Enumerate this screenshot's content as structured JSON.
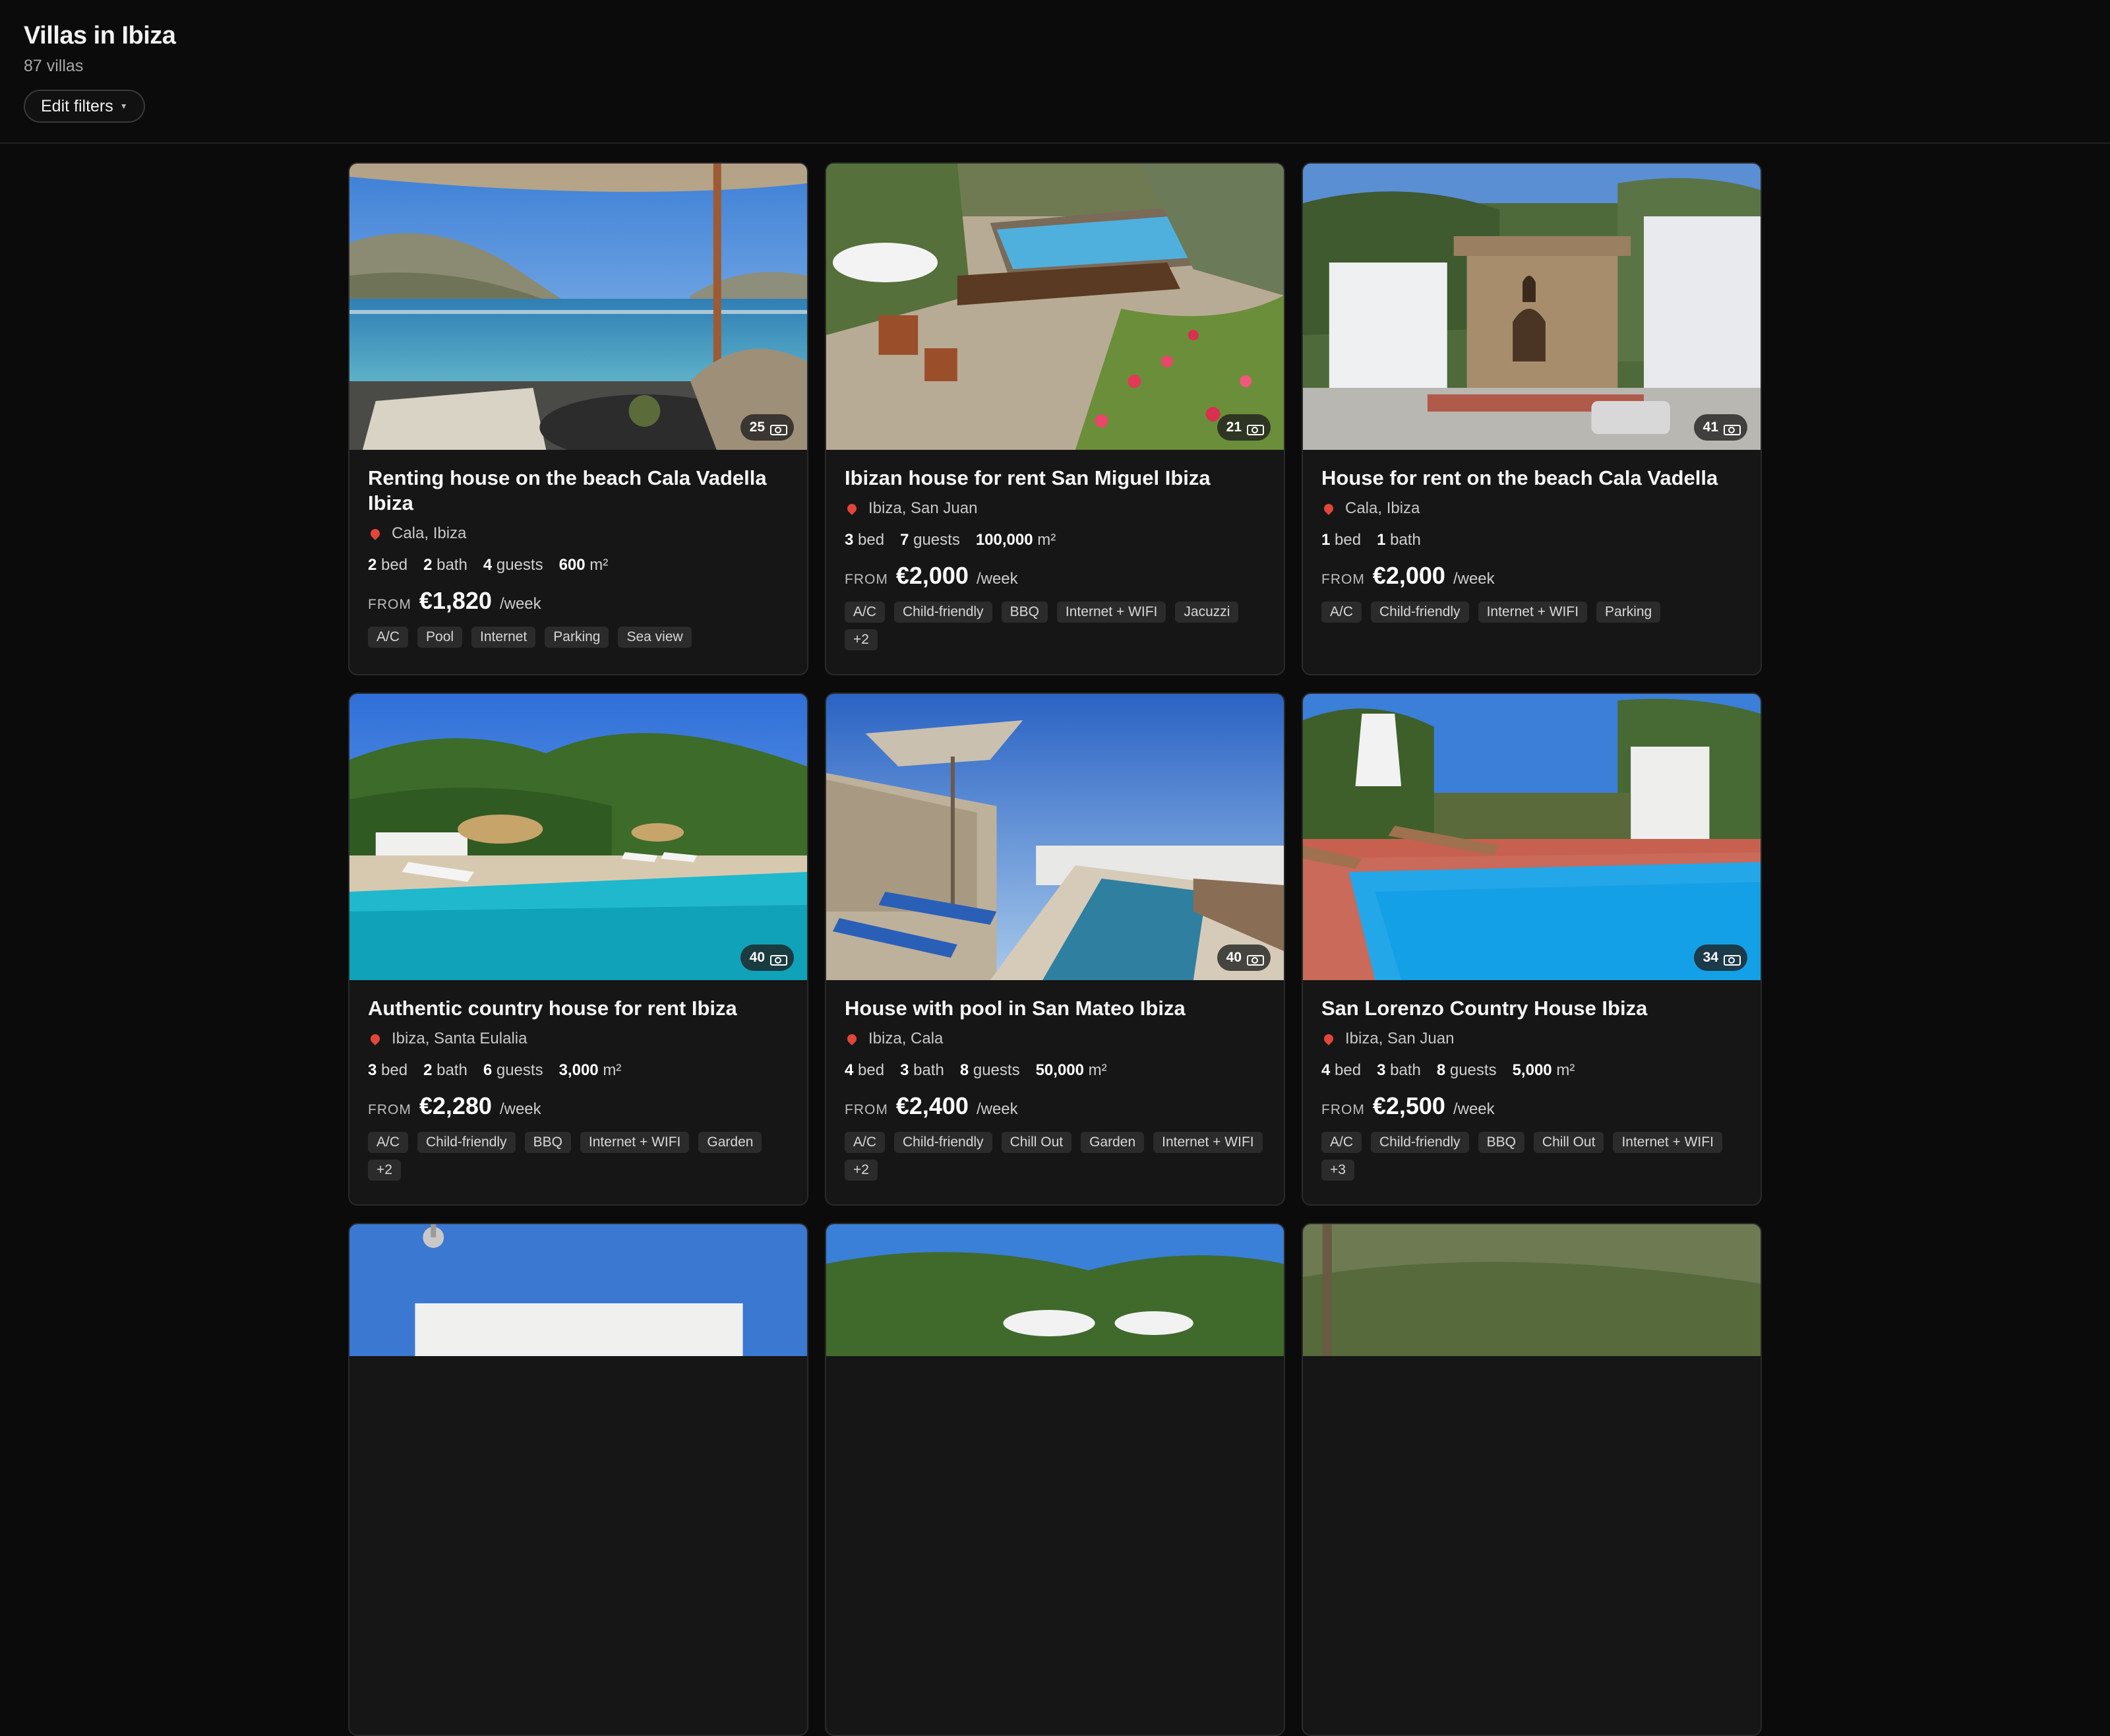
{
  "page": {
    "title": "Villas in Ibiza",
    "count": "87 villas",
    "filters_label": "Edit filters"
  },
  "listings": [
    {
      "title": "Renting house on the beach Cala Vadella Ibiza",
      "location": "Cala, Ibiza",
      "photos": "25",
      "stats": [
        {
          "value": "2",
          "unit": "bed"
        },
        {
          "value": "2",
          "unit": "bath"
        },
        {
          "value": "4",
          "unit": "guests"
        },
        {
          "value": "600",
          "unit": "m²"
        }
      ],
      "from": "FROM",
      "price": "€1,820",
      "per": "/week",
      "tags": [
        "A/C",
        "Pool",
        "Internet",
        "Parking",
        "Sea view"
      ]
    },
    {
      "title": "Ibizan house for rent San Miguel Ibiza",
      "location": "Ibiza, San Juan",
      "photos": "21",
      "stats": [
        {
          "value": "3",
          "unit": "bed"
        },
        {
          "value": "7",
          "unit": "guests"
        },
        {
          "value": "100,000",
          "unit": "m²"
        }
      ],
      "from": "FROM",
      "price": "€2,000",
      "per": "/week",
      "tags": [
        "A/C",
        "Child-friendly",
        "BBQ",
        "Internet + WIFI",
        "Jacuzzi",
        "+2"
      ]
    },
    {
      "title": "House for rent on the beach Cala Vadella",
      "location": "Cala, Ibiza",
      "photos": "41",
      "stats": [
        {
          "value": "1",
          "unit": "bed"
        },
        {
          "value": "1",
          "unit": "bath"
        }
      ],
      "from": "FROM",
      "price": "€2,000",
      "per": "/week",
      "tags": [
        "A/C",
        "Child-friendly",
        "Internet + WIFI",
        "Parking"
      ]
    },
    {
      "title": "Authentic country house for rent Ibiza",
      "location": "Ibiza, Santa Eulalia",
      "photos": "40",
      "stats": [
        {
          "value": "3",
          "unit": "bed"
        },
        {
          "value": "2",
          "unit": "bath"
        },
        {
          "value": "6",
          "unit": "guests"
        },
        {
          "value": "3,000",
          "unit": "m²"
        }
      ],
      "from": "FROM",
      "price": "€2,280",
      "per": "/week",
      "tags": [
        "A/C",
        "Child-friendly",
        "BBQ",
        "Internet + WIFI",
        "Garden",
        "+2"
      ]
    },
    {
      "title": "House with pool in San Mateo Ibiza",
      "location": "Ibiza, Cala",
      "photos": "40",
      "stats": [
        {
          "value": "4",
          "unit": "bed"
        },
        {
          "value": "3",
          "unit": "bath"
        },
        {
          "value": "8",
          "unit": "guests"
        },
        {
          "value": "50,000",
          "unit": "m²"
        }
      ],
      "from": "FROM",
      "price": "€2,400",
      "per": "/week",
      "tags": [
        "A/C",
        "Child-friendly",
        "Chill Out",
        "Garden",
        "Internet + WIFI",
        "+2"
      ]
    },
    {
      "title": "San Lorenzo Country House Ibiza",
      "location": "Ibiza, San Juan",
      "photos": "34",
      "stats": [
        {
          "value": "4",
          "unit": "bed"
        },
        {
          "value": "3",
          "unit": "bath"
        },
        {
          "value": "8",
          "unit": "guests"
        },
        {
          "value": "5,000",
          "unit": "m²"
        }
      ],
      "from": "FROM",
      "price": "€2,500",
      "per": "/week",
      "tags": [
        "A/C",
        "Child-friendly",
        "BBQ",
        "Chill Out",
        "Internet + WIFI",
        "+3"
      ]
    }
  ],
  "icons": {
    "location": "pin-icon",
    "photos": "camera-icon",
    "filters_caret": "caret-down-icon"
  }
}
